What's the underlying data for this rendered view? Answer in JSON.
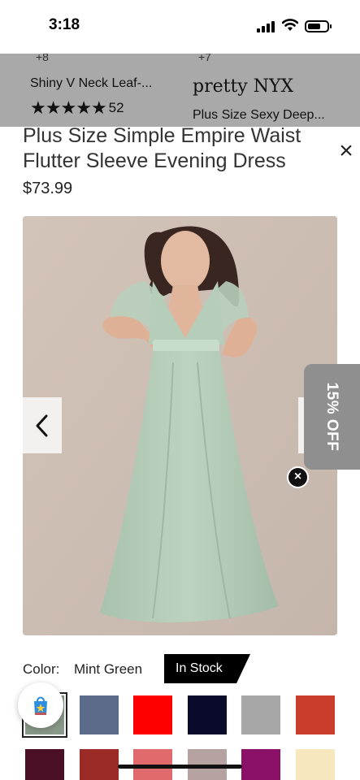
{
  "status_bar": {
    "time": "3:18",
    "icons": [
      "signal-icon",
      "wifi-icon",
      "battery-icon"
    ]
  },
  "recommendations": [
    {
      "count": "+8",
      "name": "Shiny V Neck Leaf-...",
      "rating": 5,
      "review_count": "52"
    },
    {
      "count": "+7",
      "brand": "pretty NYX",
      "name": "Plus Size Sexy Deep..."
    }
  ],
  "product": {
    "title": "Plus Size Simple Empire Waist Flutter Sleeve Evening Dress",
    "price": "$73.99",
    "image_description": "mint-green-dress-photo"
  },
  "discount": {
    "label": "15% OFF"
  },
  "color": {
    "label": "Color:",
    "selected": "Mint Green",
    "stock": "In Stock",
    "swatches": [
      {
        "name": "Mint Green",
        "color": "#8a9a8a"
      },
      {
        "name": "Slate Blue",
        "color": "#5c6b89"
      },
      {
        "name": "Red",
        "color": "#ff0000"
      },
      {
        "name": "Navy",
        "color": "#0a0b2a"
      },
      {
        "name": "Grey",
        "color": "#a7a7a7"
      },
      {
        "name": "Orange Red",
        "color": "#c93d2c"
      },
      {
        "name": "Burgundy",
        "color": "#4a0f25"
      },
      {
        "name": "Dark Red",
        "color": "#9b2b27"
      },
      {
        "name": "Coral",
        "color": "#e06a6c"
      },
      {
        "name": "Dusty Rose",
        "color": "#b7a2a2"
      },
      {
        "name": "Magenta",
        "color": "#8a1167"
      },
      {
        "name": "Champagne",
        "color": "#f6e7bd"
      }
    ]
  },
  "colors": {
    "recommendation_bar": "#a9a9a9",
    "badge": "#000000",
    "discount_tab": "#8f8f8f"
  }
}
